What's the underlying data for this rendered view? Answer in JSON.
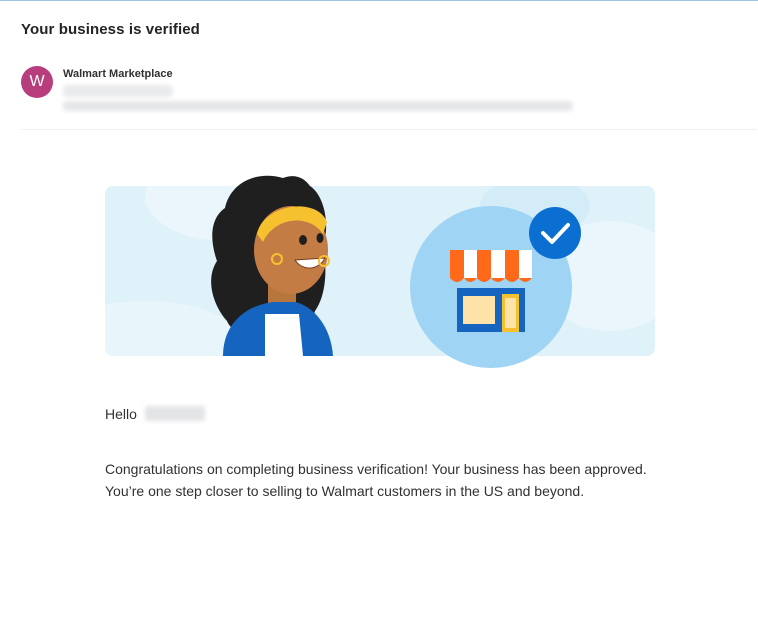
{
  "email": {
    "subject": "Your business is verified",
    "sender": {
      "avatar_initial": "W",
      "avatar_color": "#b83d7c",
      "name": "Walmart Marketplace"
    },
    "banner": {
      "icons": [
        "woman-illustration",
        "storefront-icon",
        "checkmark-icon"
      ],
      "colors": {
        "background": "#dff1f9",
        "store_circle": "#9fd4f4",
        "check_badge": "#0a6fd1",
        "awning_orange": "#ff6a1a",
        "store_blue": "#1565c0"
      }
    },
    "greeting": "Hello",
    "body": "Congratulations on completing business verification! Your business has been approved. You’re one step closer to selling to Walmart customers in the US and beyond."
  }
}
